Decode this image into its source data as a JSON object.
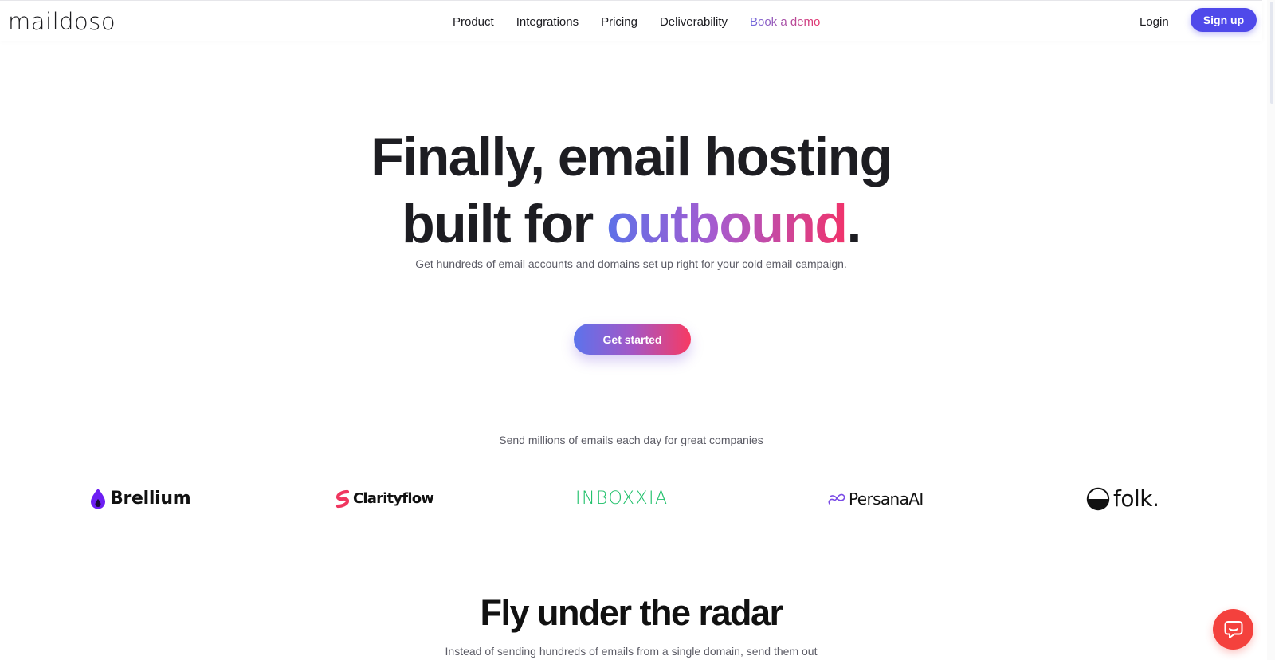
{
  "header": {
    "logo": "maildoso",
    "nav": [
      {
        "label": "Product"
      },
      {
        "label": "Integrations"
      },
      {
        "label": "Pricing"
      },
      {
        "label": "Deliverability"
      },
      {
        "label": "Book a demo"
      }
    ],
    "login_label": "Login",
    "signup_label": "Sign up"
  },
  "hero": {
    "title_line1": "Finally, email hosting",
    "title_line2_prefix": "built for ",
    "title_highlight": "outbound",
    "title_suffix": ".",
    "subtitle": "Get hundreds of email accounts and domains set up right for your cold email campaign.",
    "cta_label": "Get started"
  },
  "social_proof": {
    "heading": "Send millions of emails each day for great companies",
    "logos": [
      {
        "name": "Brellium",
        "icon": "drop-icon",
        "color": "#6d1ff3"
      },
      {
        "name": "Clarityflow",
        "icon": "clarityflow-icon",
        "color": "#f0365f"
      },
      {
        "name": "INBOXXIA",
        "icon": "",
        "color": "#1fc06a"
      },
      {
        "name": "PersanaAI",
        "icon": "infinity-icon",
        "color": "#7b4ce6"
      },
      {
        "name": "folk.",
        "icon": "half-circle-icon",
        "color": "#111111"
      }
    ]
  },
  "section2": {
    "title": "Fly under the radar",
    "subtitle": "Instead of sending hundreds of emails from a single domain, send them out"
  },
  "chat": {
    "icon": "chat-bubble-icon",
    "color": "#f4413d"
  },
  "colors": {
    "accent": "#4f49ea",
    "gradient_start": "#5d72e8",
    "gradient_end": "#f0336b"
  }
}
